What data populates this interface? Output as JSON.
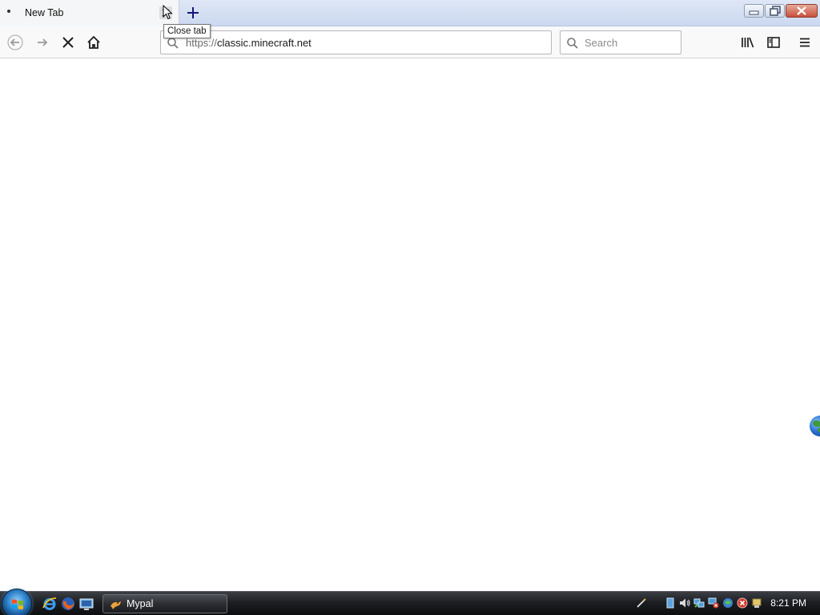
{
  "browser": {
    "tab": {
      "title": "New Tab",
      "close_tooltip": "Close tab"
    },
    "toolbar": {
      "url_scheme": "https://",
      "url_host": "classic.minecraft.net",
      "search_placeholder": "Search"
    }
  },
  "taskbar": {
    "task_button_label": "Mypal",
    "clock": "8:21 PM"
  },
  "colors": {
    "tab_active_bg": "#f5f6f7",
    "tabstrip_bg": "#cbd8f0",
    "toolbar_bg": "#f9f9fa",
    "taskbar_bg": "#1d1f23"
  },
  "icons": {
    "toolbar": [
      "back-arrow-icon",
      "forward-arrow-icon",
      "stop-icon",
      "home-icon",
      "library-icon",
      "sidebar-icon",
      "hamburger-menu-icon"
    ],
    "quick_launch": [
      "internet-explorer-icon",
      "firefox-icon",
      "show-desktop-icon"
    ],
    "tray": [
      "pen-icon",
      "tablet-icon",
      "volume-icon",
      "network-icon",
      "network-error-icon",
      "security-icon",
      "error-shield-icon",
      "safely-remove-icon"
    ]
  }
}
